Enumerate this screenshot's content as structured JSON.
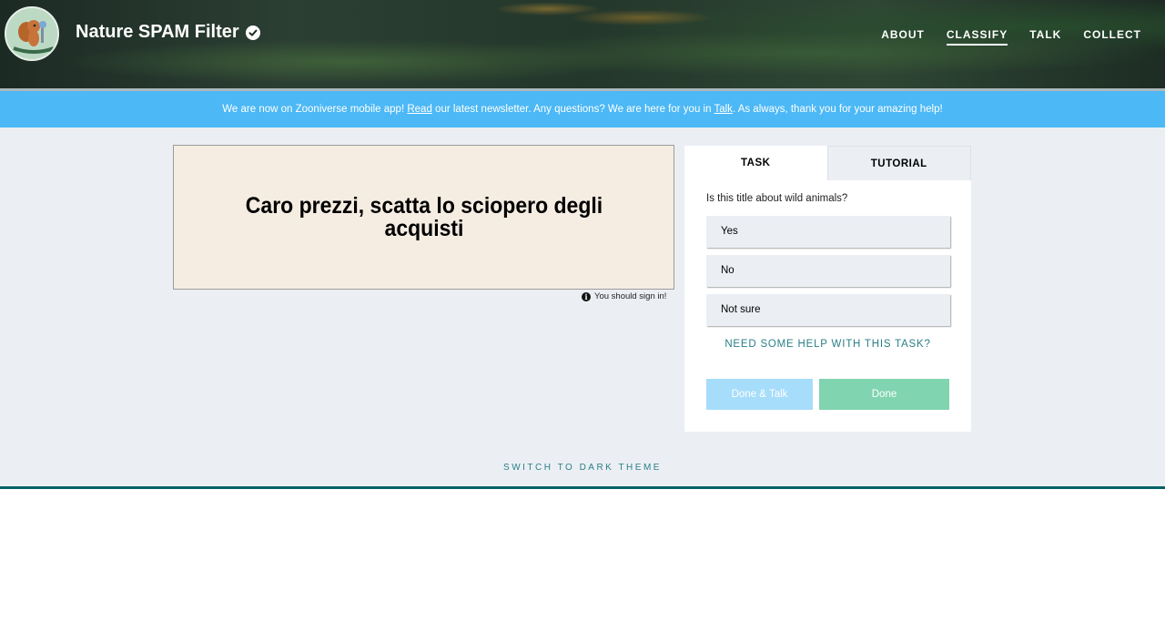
{
  "header": {
    "title": "Nature SPAM Filter",
    "nav": [
      "ABOUT",
      "CLASSIFY",
      "TALK",
      "COLLECT"
    ],
    "active_nav": "CLASSIFY"
  },
  "banner": {
    "part1": "We are now on Zooniverse mobile app! ",
    "link1": "Read",
    "part2": " our latest newsletter. Any questions? We are here for you in ",
    "link2": "Talk",
    "part3": ". As always, thank you for your amazing help!"
  },
  "subject": {
    "text": "Caro prezzi, scatta lo sciopero degli acquisti"
  },
  "signin_note": "You should sign in!",
  "task_panel": {
    "tabs": [
      "TASK",
      "TUTORIAL"
    ],
    "question": "Is this title about wild animals?",
    "answers": [
      "Yes",
      "No",
      "Not sure"
    ],
    "help_link": "NEED SOME HELP WITH THIS TASK?",
    "done_talk_label": "Done & Talk",
    "done_label": "Done"
  },
  "theme_toggle": "SWITCH TO DARK THEME",
  "colors": {
    "banner": "#4cb8f5",
    "done_button": "#80d4af",
    "done_talk_button": "#a6ddfb",
    "accent_teal": "#006166"
  }
}
